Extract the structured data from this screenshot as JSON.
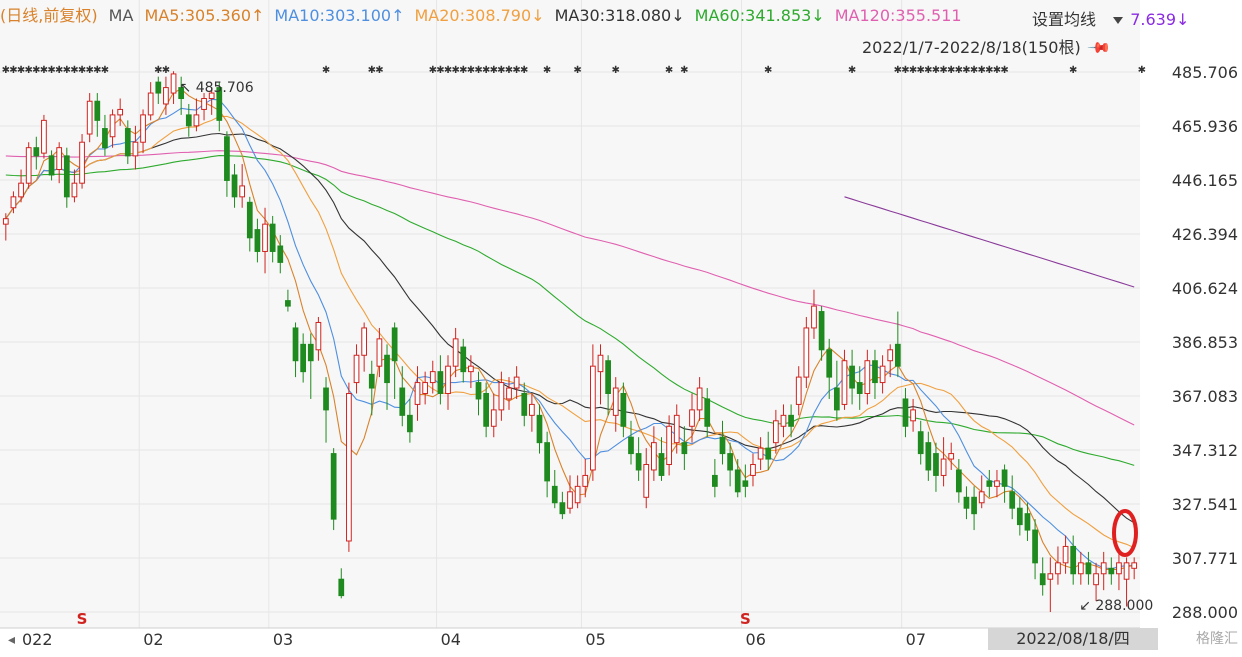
{
  "header": {
    "period_label": "(日线,前复权)",
    "ma_label": "MA",
    "ma_items": [
      {
        "label": "MA5:305.360",
        "arrow": "↑",
        "color": "#d9822b"
      },
      {
        "label": "MA10:303.100",
        "arrow": "↑",
        "color": "#4f8fe0"
      },
      {
        "label": "MA20:308.790",
        "arrow": "↓",
        "color": "#f0a040"
      },
      {
        "label": "MA30:318.080",
        "arrow": "↓",
        "color": "#333333"
      },
      {
        "label": "MA60:341.853",
        "arrow": "↓",
        "color": "#2eaa2e"
      },
      {
        "label": "MA120:355.511",
        "arrow": "",
        "color": "#e060b0"
      }
    ],
    "settings_label": "设置均线",
    "dropdown_icon": "triangle-down-icon",
    "trailing_value": "7.639↓",
    "trailing_color": "#8a2be2",
    "date_range": "2022/1/7-2022/8/18(150根)",
    "pin_icon": "pin-icon"
  },
  "annotations": {
    "high_label": "485.706",
    "low_label": "288.000",
    "bottom_date": "2022/08/18/四",
    "watermark": "格隆汇"
  },
  "colors": {
    "up": "#d0231f",
    "down": "#1f8a1f",
    "grid": "#e6e6e6",
    "ma5": "#d9822b",
    "ma10": "#4f8fe0",
    "ma20": "#f0a040",
    "ma30": "#333333",
    "ma60": "#2eaa2e",
    "ma120": "#e060b0",
    "ma250": "#8a3a9a",
    "highlight": "#e02020"
  },
  "chart_data": {
    "type": "candlestick",
    "title": "",
    "x_tick_labels": [
      "022",
      "02",
      "03",
      "04",
      "05",
      "06",
      "07"
    ],
    "y_tick_labels": [
      "485.706",
      "465.936",
      "446.165",
      "426.394",
      "406.624",
      "386.853",
      "367.083",
      "347.312",
      "327.541",
      "307.771",
      "288.000"
    ],
    "y_range": [
      288.0,
      485.706
    ],
    "high": 485.706,
    "low": 288.0,
    "dividend_markers": [
      "S",
      "S"
    ],
    "candles": [
      {
        "o": 430,
        "c": 432,
        "h": 434,
        "l": 424
      },
      {
        "o": 436,
        "c": 440,
        "h": 442,
        "l": 434
      },
      {
        "o": 440,
        "c": 445,
        "h": 450,
        "l": 438
      },
      {
        "o": 445,
        "c": 458,
        "h": 460,
        "l": 443
      },
      {
        "o": 458,
        "c": 455,
        "h": 462,
        "l": 450
      },
      {
        "o": 456,
        "c": 468,
        "h": 470,
        "l": 454
      },
      {
        "o": 455,
        "c": 448,
        "h": 457,
        "l": 446
      },
      {
        "o": 450,
        "c": 458,
        "h": 460,
        "l": 445
      },
      {
        "o": 455,
        "c": 440,
        "h": 458,
        "l": 436
      },
      {
        "o": 440,
        "c": 445,
        "h": 450,
        "l": 438
      },
      {
        "o": 445,
        "c": 460,
        "h": 463,
        "l": 443
      },
      {
        "o": 463,
        "c": 475,
        "h": 478,
        "l": 460
      },
      {
        "o": 475,
        "c": 468,
        "h": 478,
        "l": 462
      },
      {
        "o": 465,
        "c": 458,
        "h": 470,
        "l": 455
      },
      {
        "o": 462,
        "c": 470,
        "h": 472,
        "l": 458
      },
      {
        "o": 470,
        "c": 472,
        "h": 476,
        "l": 466
      },
      {
        "o": 465,
        "c": 455,
        "h": 468,
        "l": 452
      },
      {
        "o": 455,
        "c": 460,
        "h": 466,
        "l": 450
      },
      {
        "o": 460,
        "c": 470,
        "h": 472,
        "l": 456
      },
      {
        "o": 470,
        "c": 478,
        "h": 482,
        "l": 468
      },
      {
        "o": 482,
        "c": 478,
        "h": 484,
        "l": 474
      },
      {
        "o": 474,
        "c": 480,
        "h": 484,
        "l": 470
      },
      {
        "o": 478,
        "c": 485,
        "h": 486,
        "l": 474
      },
      {
        "o": 480,
        "c": 476,
        "h": 484,
        "l": 470
      },
      {
        "o": 470,
        "c": 466,
        "h": 474,
        "l": 462
      },
      {
        "o": 466,
        "c": 470,
        "h": 476,
        "l": 464
      },
      {
        "o": 472,
        "c": 476,
        "h": 478,
        "l": 468
      },
      {
        "o": 476,
        "c": 478,
        "h": 480,
        "l": 470
      },
      {
        "o": 480,
        "c": 468,
        "h": 482,
        "l": 464
      },
      {
        "o": 462,
        "c": 446,
        "h": 464,
        "l": 440
      },
      {
        "o": 448,
        "c": 440,
        "h": 452,
        "l": 436
      },
      {
        "o": 440,
        "c": 444,
        "h": 452,
        "l": 436
      },
      {
        "o": 438,
        "c": 425,
        "h": 440,
        "l": 420
      },
      {
        "o": 428,
        "c": 420,
        "h": 432,
        "l": 416
      },
      {
        "o": 420,
        "c": 430,
        "h": 436,
        "l": 412
      },
      {
        "o": 430,
        "c": 420,
        "h": 433,
        "l": 416
      },
      {
        "o": 422,
        "c": 416,
        "h": 426,
        "l": 412
      },
      {
        "o": 402,
        "c": 400,
        "h": 406,
        "l": 398
      },
      {
        "o": 392,
        "c": 380,
        "h": 394,
        "l": 374
      },
      {
        "o": 386,
        "c": 376,
        "h": 390,
        "l": 372
      },
      {
        "o": 386,
        "c": 380,
        "h": 390,
        "l": 366
      },
      {
        "o": 384,
        "c": 394,
        "h": 396,
        "l": 380
      },
      {
        "o": 370,
        "c": 362,
        "h": 374,
        "l": 350
      },
      {
        "o": 346,
        "c": 322,
        "h": 348,
        "l": 318
      },
      {
        "o": 300,
        "c": 294,
        "h": 304,
        "l": 293
      },
      {
        "o": 314,
        "c": 368,
        "h": 372,
        "l": 310
      },
      {
        "o": 372,
        "c": 382,
        "h": 386,
        "l": 368
      },
      {
        "o": 382,
        "c": 392,
        "h": 394,
        "l": 376
      },
      {
        "o": 375,
        "c": 370,
        "h": 380,
        "l": 360
      },
      {
        "o": 378,
        "c": 388,
        "h": 392,
        "l": 374
      },
      {
        "o": 382,
        "c": 372,
        "h": 386,
        "l": 362
      },
      {
        "o": 392,
        "c": 380,
        "h": 394,
        "l": 366
      },
      {
        "o": 370,
        "c": 360,
        "h": 378,
        "l": 356
      },
      {
        "o": 360,
        "c": 354,
        "h": 366,
        "l": 350
      },
      {
        "o": 364,
        "c": 372,
        "h": 378,
        "l": 358
      },
      {
        "o": 368,
        "c": 372,
        "h": 376,
        "l": 364
      },
      {
        "o": 372,
        "c": 376,
        "h": 380,
        "l": 368
      },
      {
        "o": 376,
        "c": 368,
        "h": 382,
        "l": 364
      },
      {
        "o": 368,
        "c": 378,
        "h": 382,
        "l": 362
      },
      {
        "o": 378,
        "c": 388,
        "h": 392,
        "l": 374
      },
      {
        "o": 385,
        "c": 376,
        "h": 388,
        "l": 372
      },
      {
        "o": 376,
        "c": 378,
        "h": 382,
        "l": 370
      },
      {
        "o": 372,
        "c": 366,
        "h": 376,
        "l": 360
      },
      {
        "o": 368,
        "c": 356,
        "h": 372,
        "l": 352
      },
      {
        "o": 356,
        "c": 362,
        "h": 368,
        "l": 352
      },
      {
        "o": 362,
        "c": 372,
        "h": 376,
        "l": 358
      },
      {
        "o": 366,
        "c": 370,
        "h": 374,
        "l": 362
      },
      {
        "o": 370,
        "c": 374,
        "h": 378,
        "l": 366
      },
      {
        "o": 368,
        "c": 360,
        "h": 372,
        "l": 356
      },
      {
        "o": 360,
        "c": 364,
        "h": 368,
        "l": 354
      },
      {
        "o": 360,
        "c": 350,
        "h": 364,
        "l": 346
      },
      {
        "o": 350,
        "c": 336,
        "h": 354,
        "l": 330
      },
      {
        "o": 334,
        "c": 328,
        "h": 340,
        "l": 326
      },
      {
        "o": 328,
        "c": 324,
        "h": 332,
        "l": 322
      },
      {
        "o": 326,
        "c": 332,
        "h": 338,
        "l": 324
      },
      {
        "o": 328,
        "c": 334,
        "h": 338,
        "l": 326
      },
      {
        "o": 334,
        "c": 338,
        "h": 344,
        "l": 330
      },
      {
        "o": 340,
        "c": 378,
        "h": 386,
        "l": 336
      },
      {
        "o": 376,
        "c": 382,
        "h": 386,
        "l": 364
      },
      {
        "o": 380,
        "c": 368,
        "h": 382,
        "l": 360
      },
      {
        "o": 360,
        "c": 370,
        "h": 374,
        "l": 354
      },
      {
        "o": 368,
        "c": 356,
        "h": 372,
        "l": 352
      },
      {
        "o": 352,
        "c": 346,
        "h": 358,
        "l": 342
      },
      {
        "o": 346,
        "c": 340,
        "h": 352,
        "l": 336
      },
      {
        "o": 330,
        "c": 342,
        "h": 348,
        "l": 326
      },
      {
        "o": 340,
        "c": 350,
        "h": 356,
        "l": 336
      },
      {
        "o": 346,
        "c": 338,
        "h": 352,
        "l": 336
      },
      {
        "o": 342,
        "c": 356,
        "h": 360,
        "l": 338
      },
      {
        "o": 350,
        "c": 360,
        "h": 364,
        "l": 346
      },
      {
        "o": 350,
        "c": 346,
        "h": 356,
        "l": 340
      },
      {
        "o": 356,
        "c": 362,
        "h": 368,
        "l": 350
      },
      {
        "o": 362,
        "c": 370,
        "h": 374,
        "l": 358
      },
      {
        "o": 366,
        "c": 356,
        "h": 370,
        "l": 352
      },
      {
        "o": 338,
        "c": 334,
        "h": 344,
        "l": 330
      },
      {
        "o": 352,
        "c": 346,
        "h": 358,
        "l": 342
      },
      {
        "o": 346,
        "c": 340,
        "h": 350,
        "l": 334
      },
      {
        "o": 340,
        "c": 332,
        "h": 344,
        "l": 330
      },
      {
        "o": 336,
        "c": 334,
        "h": 342,
        "l": 330
      },
      {
        "o": 338,
        "c": 342,
        "h": 346,
        "l": 334
      },
      {
        "o": 344,
        "c": 348,
        "h": 352,
        "l": 340
      },
      {
        "o": 348,
        "c": 344,
        "h": 354,
        "l": 340
      },
      {
        "o": 350,
        "c": 358,
        "h": 362,
        "l": 346
      },
      {
        "o": 356,
        "c": 360,
        "h": 364,
        "l": 352
      },
      {
        "o": 360,
        "c": 356,
        "h": 364,
        "l": 352
      },
      {
        "o": 364,
        "c": 374,
        "h": 378,
        "l": 360
      },
      {
        "o": 374,
        "c": 392,
        "h": 396,
        "l": 370
      },
      {
        "o": 392,
        "c": 400,
        "h": 406,
        "l": 388
      },
      {
        "o": 398,
        "c": 384,
        "h": 400,
        "l": 380
      },
      {
        "o": 384,
        "c": 374,
        "h": 388,
        "l": 366
      },
      {
        "o": 370,
        "c": 362,
        "h": 380,
        "l": 358
      },
      {
        "o": 364,
        "c": 380,
        "h": 384,
        "l": 362
      },
      {
        "o": 378,
        "c": 370,
        "h": 384,
        "l": 364
      },
      {
        "o": 372,
        "c": 368,
        "h": 378,
        "l": 362
      },
      {
        "o": 368,
        "c": 380,
        "h": 384,
        "l": 364
      },
      {
        "o": 380,
        "c": 372,
        "h": 384,
        "l": 366
      },
      {
        "o": 372,
        "c": 378,
        "h": 382,
        "l": 368
      },
      {
        "o": 380,
        "c": 384,
        "h": 386,
        "l": 374
      },
      {
        "o": 386,
        "c": 378,
        "h": 398,
        "l": 374
      },
      {
        "o": 366,
        "c": 356,
        "h": 370,
        "l": 352
      },
      {
        "o": 358,
        "c": 362,
        "h": 366,
        "l": 354
      },
      {
        "o": 354,
        "c": 346,
        "h": 358,
        "l": 342
      },
      {
        "o": 350,
        "c": 340,
        "h": 354,
        "l": 336
      },
      {
        "o": 346,
        "c": 338,
        "h": 350,
        "l": 332
      },
      {
        "o": 338,
        "c": 344,
        "h": 352,
        "l": 334
      },
      {
        "o": 344,
        "c": 346,
        "h": 350,
        "l": 340
      },
      {
        "o": 340,
        "c": 332,
        "h": 344,
        "l": 328
      },
      {
        "o": 330,
        "c": 326,
        "h": 334,
        "l": 322
      },
      {
        "o": 330,
        "c": 324,
        "h": 334,
        "l": 318
      },
      {
        "o": 328,
        "c": 332,
        "h": 338,
        "l": 326
      },
      {
        "o": 336,
        "c": 334,
        "h": 340,
        "l": 330
      },
      {
        "o": 334,
        "c": 336,
        "h": 340,
        "l": 330
      },
      {
        "o": 340,
        "c": 334,
        "h": 342,
        "l": 328
      },
      {
        "o": 332,
        "c": 326,
        "h": 338,
        "l": 322
      },
      {
        "o": 326,
        "c": 320,
        "h": 330,
        "l": 316
      },
      {
        "o": 324,
        "c": 318,
        "h": 328,
        "l": 314
      },
      {
        "o": 318,
        "c": 306,
        "h": 322,
        "l": 300
      },
      {
        "o": 302,
        "c": 298,
        "h": 308,
        "l": 294
      },
      {
        "o": 300,
        "c": 302,
        "h": 308,
        "l": 288
      },
      {
        "o": 302,
        "c": 306,
        "h": 312,
        "l": 298
      },
      {
        "o": 306,
        "c": 312,
        "h": 316,
        "l": 302
      },
      {
        "o": 312,
        "c": 302,
        "h": 316,
        "l": 298
      },
      {
        "o": 302,
        "c": 306,
        "h": 310,
        "l": 298
      },
      {
        "o": 306,
        "c": 302,
        "h": 310,
        "l": 298
      },
      {
        "o": 298,
        "c": 302,
        "h": 306,
        "l": 292
      },
      {
        "o": 302,
        "c": 306,
        "h": 310,
        "l": 296
      },
      {
        "o": 304,
        "c": 302,
        "h": 308,
        "l": 298
      },
      {
        "o": 302,
        "c": 306,
        "h": 310,
        "l": 296
      },
      {
        "o": 300,
        "c": 306,
        "h": 308,
        "l": 290
      },
      {
        "o": 304,
        "c": 306,
        "h": 308,
        "l": 300
      }
    ],
    "ma_lines": [
      {
        "name": "MA5",
        "values_key": "ma5"
      },
      {
        "name": "MA10",
        "values_key": "ma10"
      },
      {
        "name": "MA20",
        "values_key": "ma20"
      },
      {
        "name": "MA30",
        "values_key": "ma30"
      },
      {
        "name": "MA60",
        "values_key": "ma60"
      },
      {
        "name": "MA120",
        "values_key": "ma120"
      },
      {
        "name": "MA250",
        "values_key": "ma250"
      }
    ],
    "ma250_visible_from_index": 110,
    "ma250_start_value": 440,
    "ma250_end_value": 407,
    "ma120_start_value": 455,
    "ma60_start_value": 448
  }
}
